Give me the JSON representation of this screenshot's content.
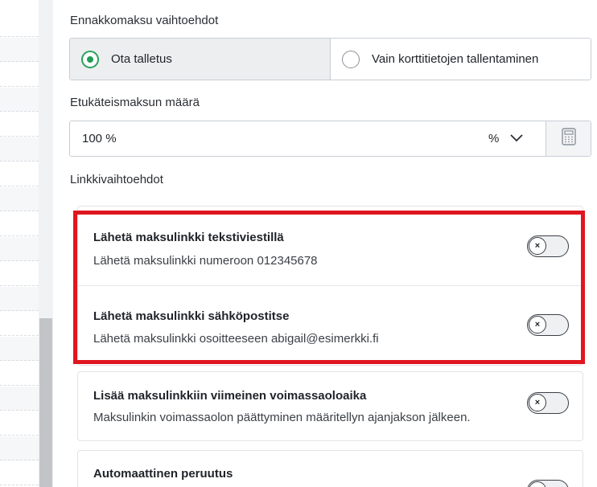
{
  "prepayment_options": {
    "label": "Ennakkomaksu vaihtoehdot",
    "options": [
      {
        "label": "Ota talletus",
        "selected": true
      },
      {
        "label": "Vain korttitietojen tallentaminen",
        "selected": false
      }
    ]
  },
  "amount": {
    "label": "Etukäteismaksun määrä",
    "value": "100 %",
    "unit": "%",
    "calculator_icon": "calculator-icon"
  },
  "link_options": {
    "label": "Linkkivaihtoehdot",
    "items": [
      {
        "title": "Lähetä maksulinkki tekstiviestillä",
        "description": "Lähetä maksulinkki numeroon 012345678",
        "enabled": false
      },
      {
        "title": "Lähetä maksulinkki sähköpostitse",
        "description": "Lähetä maksulinkki osoitteeseen abigail@esimerkki.fi",
        "enabled": false
      },
      {
        "title": "Lisää maksulinkkiin viimeinen voimassaoloaika",
        "description": "Maksulinkin voimassaolon päättyminen määritellyn ajanjakson jälkeen.",
        "enabled": false
      },
      {
        "title": "Automaattinen peruutus",
        "enabled": false
      }
    ],
    "toggle_off_glyph": "×"
  },
  "colors": {
    "accent": "#1f9d55",
    "highlight": "#e0161f"
  }
}
